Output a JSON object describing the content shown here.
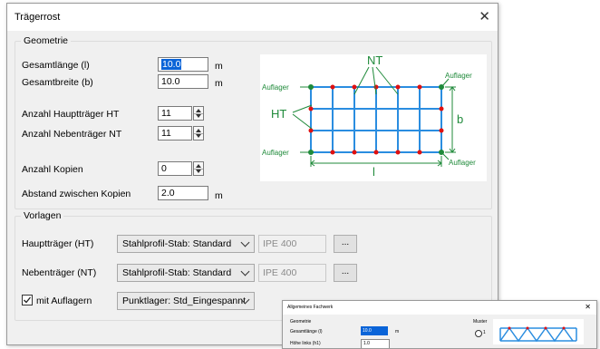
{
  "dialog": {
    "title": "Trägerrost",
    "close_glyph": "✕",
    "geometry": {
      "legend": "Geometrie",
      "length_label": "Gesamtlänge (l)",
      "length_value": "10.0",
      "length_unit": "m",
      "width_label": "Gesamtbreite (b)",
      "width_value": "10.0",
      "width_unit": "m",
      "main_count_label": "Anzahl Hauptträger HT",
      "main_count_value": "11",
      "sec_count_label": "Anzahl Nebenträger NT",
      "sec_count_value": "11",
      "copies_label": "Anzahl Kopien",
      "copies_value": "0",
      "spacing_label": "Abstand zwischen Kopien",
      "spacing_value": "2.0",
      "spacing_unit": "m"
    },
    "diagram": {
      "nt": "NT",
      "ht": "HT",
      "b": "b",
      "l": "l",
      "support": "Auflager",
      "beam_color": "#2a8de0",
      "node_color": "#e01010",
      "support_color": "#1f8a3a"
    },
    "templates": {
      "legend": "Vorlagen",
      "main_label": "Hauptträger (HT)",
      "main_combo": "Stahlprofil-Stab: Standard",
      "main_profile": "IPE 400",
      "main_btn": "...",
      "sec_label": "Nebenträger (NT)",
      "sec_combo": "Stahlprofil-Stab: Standard",
      "sec_profile": "IPE 400",
      "sec_btn": "...",
      "supports_label": "mit Auflagern",
      "supports_checked": true,
      "supports_combo": "Punktlager: Std_Eingespannt"
    }
  },
  "inset": {
    "title": "Allgemeines Fachwerk",
    "close_glyph": "✕",
    "legend": "Geometrie",
    "length_label": "Gesamtlänge (l)",
    "length_value": "10.0",
    "length_unit": "m",
    "height_label": "Höhe links (h1)",
    "height_value": "1.0",
    "pattern_label": "Muster",
    "option_label": "1"
  }
}
